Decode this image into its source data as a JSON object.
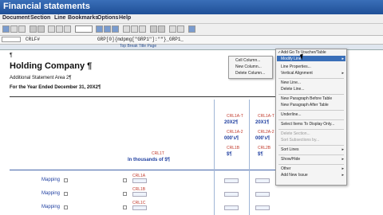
{
  "window": {
    "title": "Financial statements"
  },
  "menubar": {
    "items": [
      "Document",
      "Section",
      "Line",
      "Bookmarks",
      "Options",
      "Help"
    ]
  },
  "formula": {
    "left": "CRLF#",
    "right": "GRP[0]{mdpmg[\"GRP1\"]:\"\"}_GRP1_"
  },
  "ruler": {
    "label": "Top Break Title Page"
  },
  "document": {
    "para_mark": "¶",
    "title": "Holding Company ¶",
    "subtitle": "Additional Statement Area 2¶",
    "date_line": "For the Year Ended December 31, 20X2¶",
    "col_tokens_a": [
      "CRL1A-T",
      "CRL1A-T"
    ],
    "col_years": [
      "20X2¶",
      "20X1¶"
    ],
    "col_tokens_b": [
      "CRL1A-2",
      "CRL2A-2"
    ],
    "col_amount": [
      "000's¶",
      "000's¶"
    ],
    "col_tokens_c": [
      "CRL1B",
      "CRL2B"
    ],
    "col_dollars": [
      "$¶",
      "$¶"
    ],
    "thousands_token": "CRL1T",
    "thousands": "In thousands of $¶",
    "mapping_label": "Mapping",
    "row_tokens": [
      "CRL1A",
      "CRL1B",
      "CRL1C"
    ]
  },
  "context_menu_small": {
    "items": [
      "Cell Column...",
      "New Column...",
      "Delete Column..."
    ]
  },
  "context_menu": {
    "items": [
      {
        "label": "Add Go To Voucher/Table",
        "checked": true
      },
      {
        "label": "Modify Line",
        "highlight": true,
        "submenu": true
      },
      {
        "label": "Line Properties..."
      },
      {
        "label": "Vertical Alignment",
        "submenu": true
      },
      {
        "label": "New Line..."
      },
      {
        "label": "Delete Line..."
      },
      {
        "label": "New Paragraph Before Table"
      },
      {
        "label": "New Paragraph After Table"
      },
      {
        "label": "Underline..."
      },
      {
        "label": "Select Items To Display Only..."
      },
      {
        "label": "Delete Section...",
        "disabled": true
      },
      {
        "label": "Sort Subsections by...",
        "disabled": true
      },
      {
        "label": "Sort Lines",
        "submenu": true
      },
      {
        "label": "Show/Hide",
        "submenu": true
      },
      {
        "label": "Other",
        "submenu": true
      },
      {
        "label": "Add New Issue",
        "submenu": true
      }
    ]
  }
}
